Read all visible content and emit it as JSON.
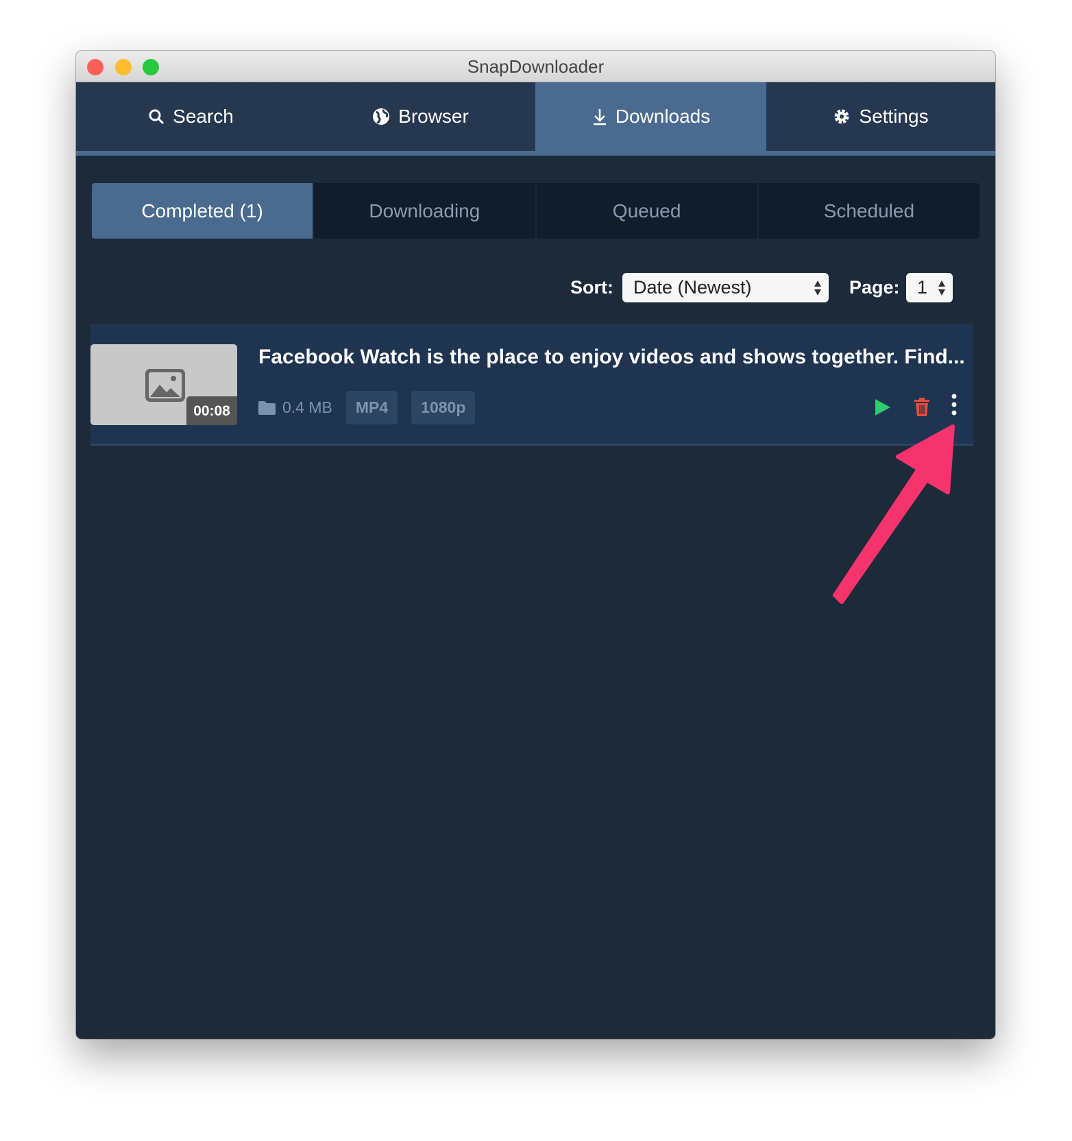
{
  "window": {
    "title": "SnapDownloader"
  },
  "nav": {
    "tabs": [
      {
        "label": "Search",
        "icon": "search-icon"
      },
      {
        "label": "Browser",
        "icon": "globe-icon"
      },
      {
        "label": "Downloads",
        "icon": "download-icon",
        "active": true
      },
      {
        "label": "Settings",
        "icon": "gear-icon"
      }
    ]
  },
  "subtabs": [
    {
      "label": "Completed (1)",
      "active": true
    },
    {
      "label": "Downloading"
    },
    {
      "label": "Queued"
    },
    {
      "label": "Scheduled"
    }
  ],
  "toolbar": {
    "sort_label": "Sort:",
    "sort_value": "Date (Newest)",
    "page_label": "Page:",
    "page_value": "1"
  },
  "downloads": [
    {
      "title": "Facebook Watch is the place to enjoy videos and shows together. Find...",
      "duration": "00:08",
      "size": "0.4 MB",
      "format": "MP4",
      "resolution": "1080p"
    }
  ],
  "colors": {
    "accent": "#4a6b8f",
    "background": "#1c2a3a",
    "play": "#2ecc71",
    "delete": "#e74c3c",
    "annotation_arrow": "#f5336c"
  }
}
